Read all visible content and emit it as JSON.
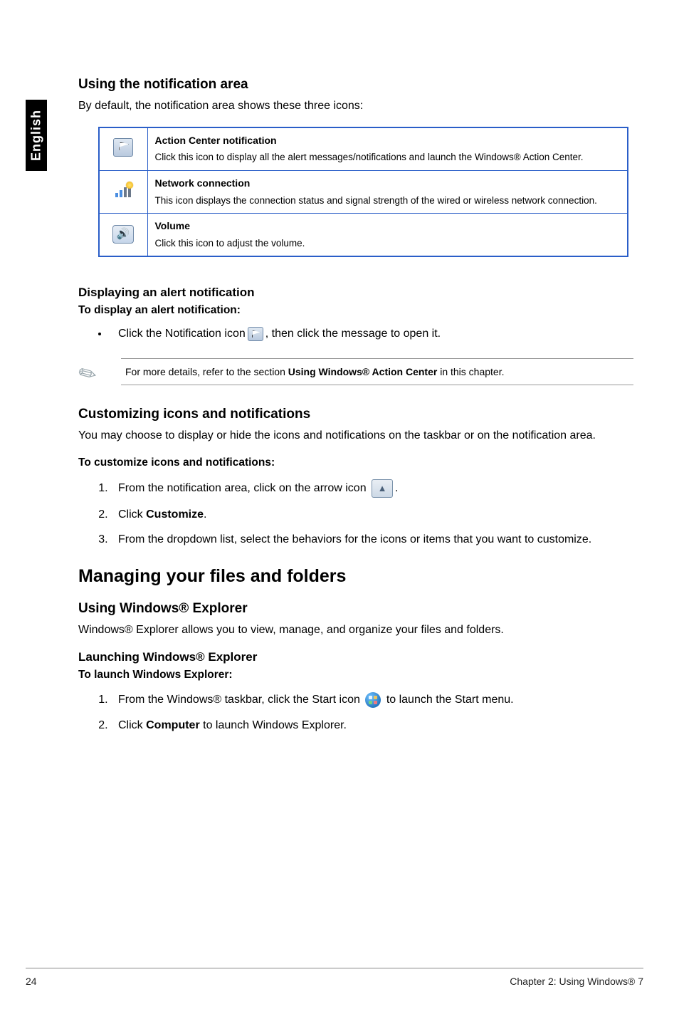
{
  "sideTab": "English",
  "notifArea": {
    "heading": "Using the notification area",
    "intro": "By default, the notification area shows these three icons:",
    "rows": [
      {
        "title": "Action Center notification",
        "desc": "Click this icon to display all the alert messages/notifications and launch the Windows® Action Center."
      },
      {
        "title": "Network connection",
        "desc": "This icon displays the connection status and signal strength of the wired or wireless network connection."
      },
      {
        "title": "Volume",
        "desc": "Click this icon to adjust the volume."
      }
    ]
  },
  "alertNotif": {
    "heading": "Displaying an alert notification",
    "subhead": "To display an alert notification:",
    "bulletPre": "Click the Notification icon ",
    "bulletPost": ", then click the message to open it."
  },
  "note": {
    "pre": "For more details, refer to the section ",
    "bold": "Using Windows® Action Center",
    "post": " in this chapter."
  },
  "customize": {
    "heading": "Customizing icons and notifications",
    "intro": "You may choose to display or hide the icons and notifications on the taskbar or on the notification area.",
    "subhead": "To customize icons and notifications:",
    "steps": {
      "s1pre": "From the notification area, click on the arrow icon ",
      "s1post": ".",
      "s2pre": "Click ",
      "s2bold": "Customize",
      "s2post": ".",
      "s3": "From the dropdown list, select the behaviors for the icons or items that you want to customize."
    }
  },
  "managing": {
    "heading": "Managing your files and folders",
    "usingExplorer": "Using Windows® Explorer",
    "explorerIntro": "Windows® Explorer allows you to view, manage, and organize your files and folders.",
    "launchHeading": "Launching Windows® Explorer",
    "launchSub": "To launch Windows Explorer:",
    "steps": {
      "s1pre": "From the Windows® taskbar, click the Start icon ",
      "s1post": " to launch the Start menu.",
      "s2pre": "Click ",
      "s2bold": "Computer",
      "s2post": " to launch Windows Explorer."
    }
  },
  "footer": {
    "page": "24",
    "chapter": "Chapter 2: Using Windows® 7"
  }
}
